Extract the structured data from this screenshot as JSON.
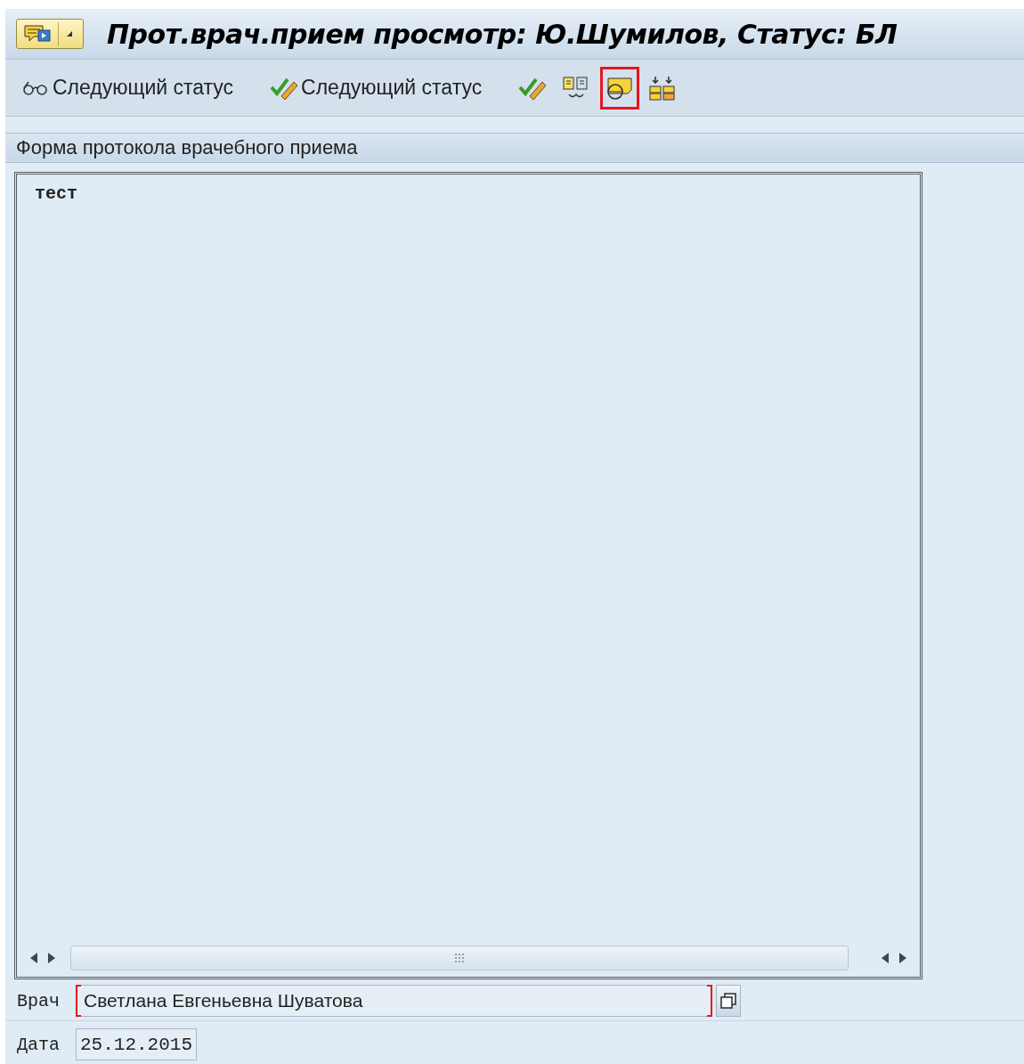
{
  "window": {
    "title": "Прот.врач.прием просмотр: Ю.Шумилов, Статус: БЛ"
  },
  "toolbar": [
    {
      "label": "Следующий статус",
      "highlighted": false
    },
    {
      "label": "Следующий статус",
      "highlighted": false
    },
    {
      "highlighted": false
    },
    {
      "highlighted": false
    },
    {
      "highlighted": true
    },
    {
      "highlighted": false
    }
  ],
  "section": {
    "title": "Форма протокола врачебного приема"
  },
  "editor": {
    "text": "тест"
  },
  "fields": [
    {
      "label": "Врач",
      "value": "Светлана Евгеньевна Шуватова",
      "required": true,
      "kind": "lookup"
    },
    {
      "label": "Дата",
      "value": "25.12.2015",
      "required": false,
      "kind": "plain"
    }
  ]
}
